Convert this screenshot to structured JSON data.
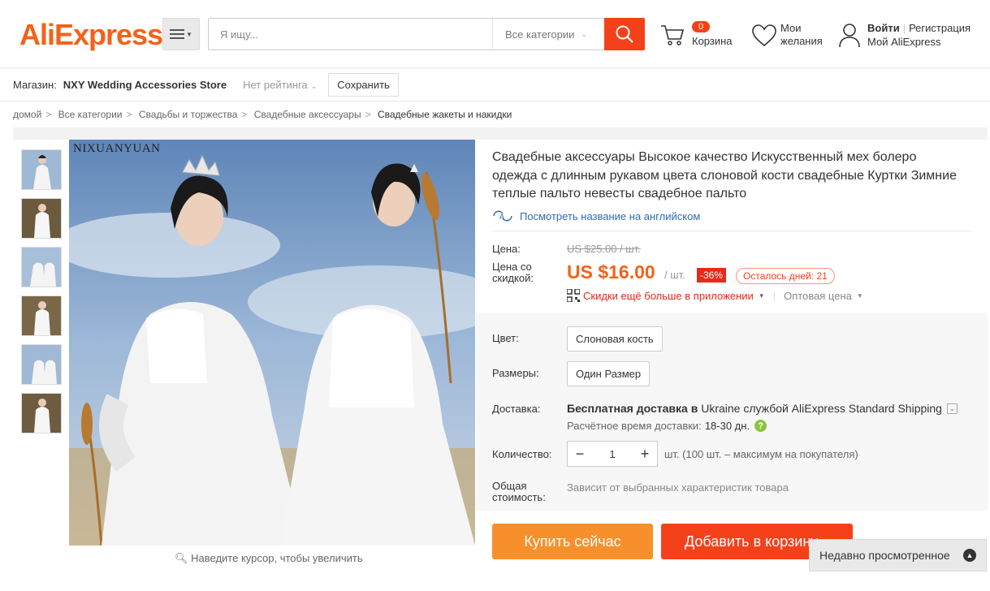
{
  "header": {
    "logo": "AliExpress",
    "logo_tm": "™",
    "search_placeholder": "Я ищу...",
    "search_category": "Все категории",
    "cart_count": "0",
    "cart_label": "Корзина",
    "wishlist_label_1": "Мои",
    "wishlist_label_2": "желания",
    "login": "Войти",
    "register": "Регистрация",
    "my_account": "Мой AliExpress"
  },
  "store": {
    "label": "Магазин:",
    "name": "NXY Wedding Accessories Store",
    "rating": "Нет рейтинга",
    "save": "Сохранить"
  },
  "breadcrumb": [
    "домой",
    "Все категории",
    "Свадьбы и торжества",
    "Свадебные аксессуары",
    "Свадебные жакеты и накидки"
  ],
  "gallery": {
    "brand_watermark": "NIXUANYUAN",
    "zoom_hint": "Наведите курсор, чтобы увеличить"
  },
  "product": {
    "title": "Свадебные аксессуары Высокое качество Искусственный мех болеро одежда с длинным рукавом цвета слоновой кости свадебные Куртки Зимние теплые пальто невесты свадебное пальто",
    "translate_link": "Посмотреть название на английском",
    "price_label": "Цена:",
    "old_price": "US $25.00 / шт.",
    "discount_label": "Цена со скидкой:",
    "new_price": "US $16.00",
    "per_unit": "/ шт.",
    "discount": "-36%",
    "days_left": "Осталось дней: 21",
    "app_deal": "Скидки ещё больше в приложении",
    "wholesale": "Оптовая цена",
    "color_label": "Цвет:",
    "color_value": "Слоновая кость",
    "size_label": "Размеры:",
    "size_value": "Один Размер",
    "shipping_label": "Доставка:",
    "shipping_free": "Бесплатная доставка в",
    "shipping_country": "Ukraine",
    "shipping_via": "службой AliExpress Standard Shipping",
    "eta_label": "Расчётное время доставки:",
    "eta_value": "18-30 дн.",
    "qty_label": "Количество:",
    "qty_value": "1",
    "qty_note": "шт. (100 шт. – максимум на покупателя)",
    "total_label": "Общая стоимость:",
    "total_value": "Зависит от выбранных характеристик товара",
    "buy_now": "Купить сейчас",
    "add_to_cart": "Добавить в корзину"
  },
  "recently_viewed": "Недавно просмотренное",
  "colors": {
    "accent": "#f4611a",
    "red": "#f4411a",
    "buy": "#f7902b",
    "link": "#2d6ab6"
  }
}
